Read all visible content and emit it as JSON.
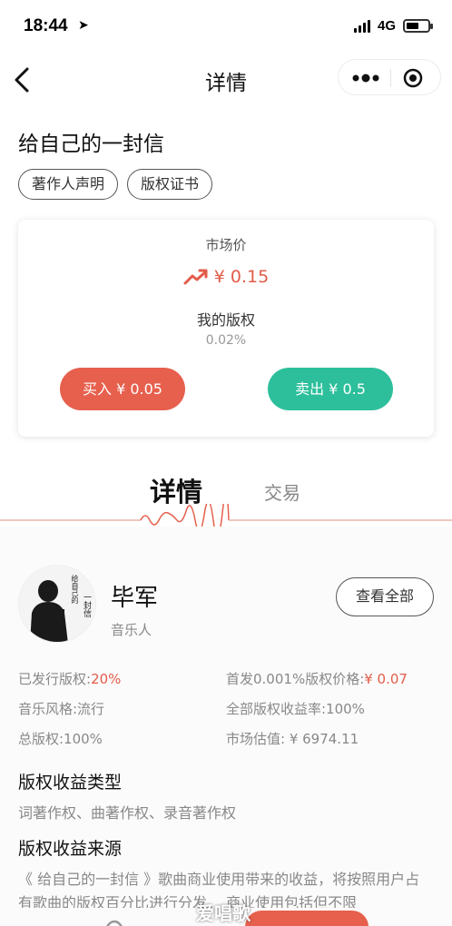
{
  "status": {
    "time": "18:44",
    "network": "4G"
  },
  "nav": {
    "title": "详情"
  },
  "song": {
    "title": "给自己的一封信"
  },
  "tags": [
    "著作人声明",
    "版权证书"
  ],
  "card": {
    "market_label": "市场价",
    "market_price": "¥ 0.15",
    "my_label": "我的版权",
    "my_percent": "0.02%",
    "buy_label": "买入 ¥ 0.05",
    "sell_label": "卖出 ¥ 0.5"
  },
  "tabs": {
    "detail": "详情",
    "trade": "交易"
  },
  "artist": {
    "name": "毕军",
    "role": "音乐人",
    "view_all": "查看全部",
    "avatar_text": [
      "给自己的",
      "一封信"
    ]
  },
  "info": {
    "issued_label": "已发行版权:",
    "issued_value": "20%",
    "first_price_label": "首发0.001%版权价格:",
    "first_price_value": "¥ 0.07",
    "style": "音乐风格:流行",
    "yield": "全部版权收益率:100%",
    "total": "总版权:100%",
    "valuation": "市场估值: ¥ 6974.11"
  },
  "revenue_type": {
    "title": "版权收益类型",
    "text": "词著作权、曲著作权、录音著作权"
  },
  "revenue_source": {
    "title": "版权收益来源",
    "text": "《 给自己的一封信 》歌曲商业使用带来的收益，将按照用户占有歌曲的版权百分比进行分发。 商业使用包括但不限"
  },
  "watermark": "爱唱歌",
  "colors": {
    "accent_red": "#e6604d",
    "accent_green": "#2dbf9b",
    "price_red": "#e25c4a"
  }
}
